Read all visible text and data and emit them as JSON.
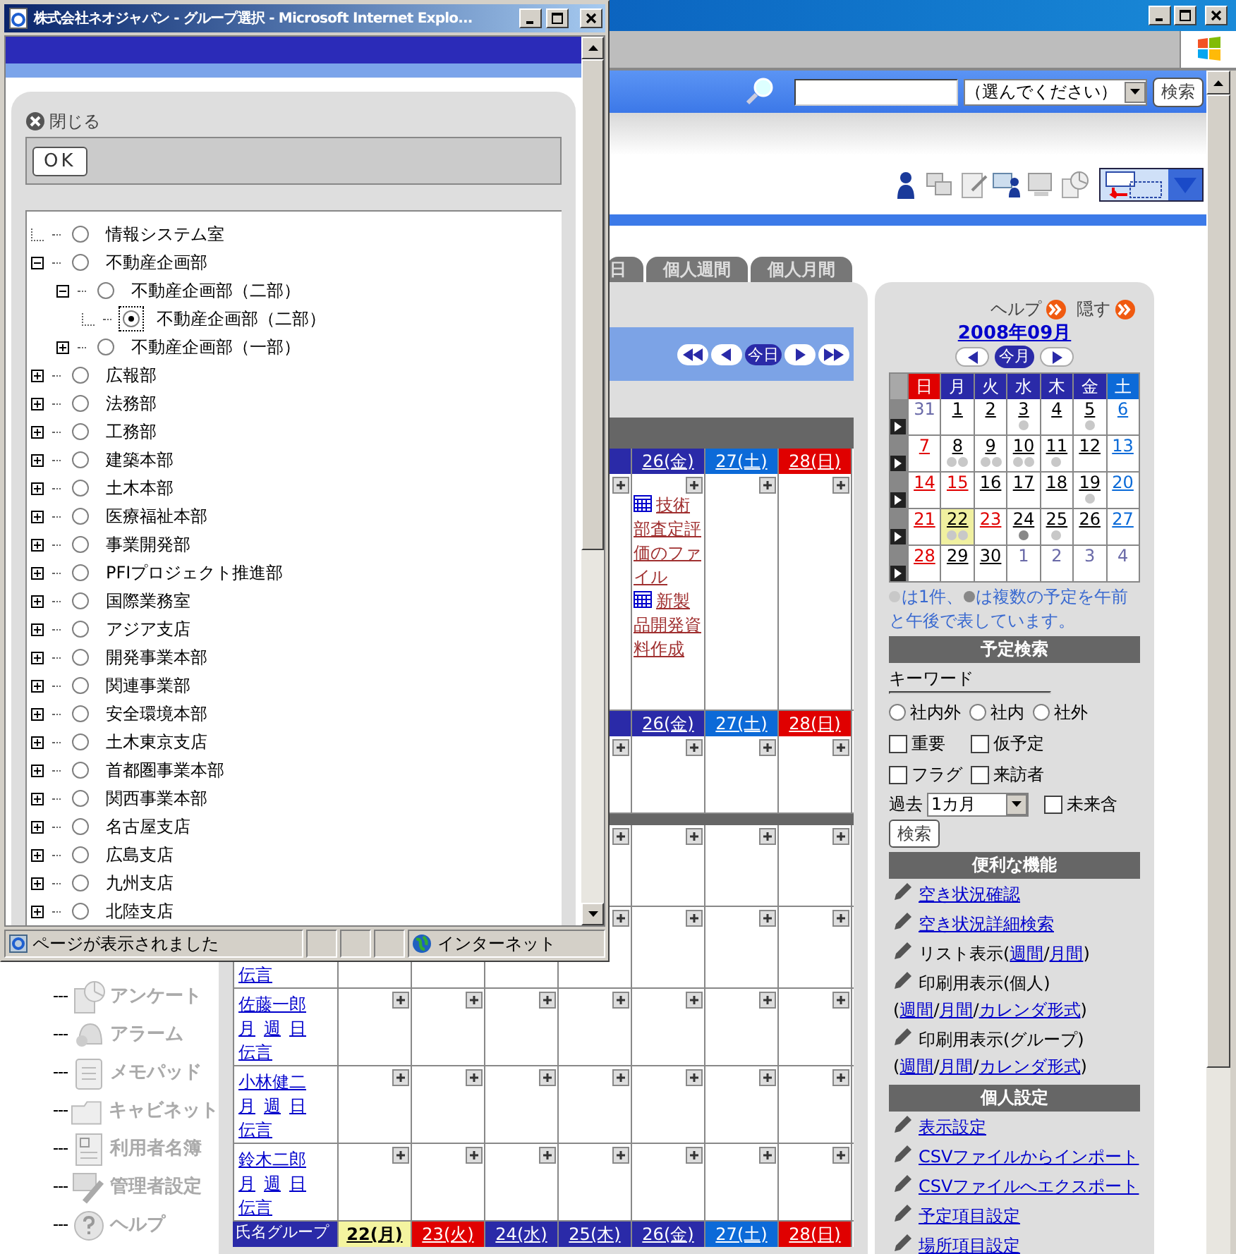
{
  "popup": {
    "title": "株式会社ネオジャパン - グループ選択 - Microsoft Internet Explo...",
    "close_label": "閉じる",
    "ok_button": "OK",
    "tree": [
      {
        "label": "情報システム室",
        "kind": "leaf",
        "selected": false
      },
      {
        "label": "不動産企画部",
        "kind": "branch",
        "expanded": true,
        "selected": false,
        "children": [
          {
            "label": "不動産企画部（二部）",
            "kind": "branch",
            "expanded": true,
            "selected": false,
            "children": [
              {
                "label": "不動産企画部（二部）",
                "kind": "leaf",
                "selected": true
              }
            ]
          },
          {
            "label": "不動産企画部（一部）",
            "kind": "branch",
            "expanded": false,
            "selected": false
          }
        ]
      },
      {
        "label": "広報部",
        "kind": "branch",
        "expanded": false,
        "selected": false
      },
      {
        "label": "法務部",
        "kind": "branch",
        "expanded": false,
        "selected": false
      },
      {
        "label": "工務部",
        "kind": "branch",
        "expanded": false,
        "selected": false
      },
      {
        "label": "建築本部",
        "kind": "branch",
        "expanded": false,
        "selected": false
      },
      {
        "label": "土木本部",
        "kind": "branch",
        "expanded": false,
        "selected": false
      },
      {
        "label": "医療福祉本部",
        "kind": "branch",
        "expanded": false,
        "selected": false
      },
      {
        "label": "事業開発部",
        "kind": "branch",
        "expanded": false,
        "selected": false
      },
      {
        "label": "PFIプロジェクト推進部",
        "kind": "branch",
        "expanded": false,
        "selected": false
      },
      {
        "label": "国際業務室",
        "kind": "branch",
        "expanded": false,
        "selected": false
      },
      {
        "label": "アジア支店",
        "kind": "branch",
        "expanded": false,
        "selected": false
      },
      {
        "label": "開発事業本部",
        "kind": "branch",
        "expanded": false,
        "selected": false
      },
      {
        "label": "関連事業部",
        "kind": "branch",
        "expanded": false,
        "selected": false
      },
      {
        "label": "安全環境本部",
        "kind": "branch",
        "expanded": false,
        "selected": false
      },
      {
        "label": "土木東京支店",
        "kind": "branch",
        "expanded": false,
        "selected": false
      },
      {
        "label": "首都圏事業本部",
        "kind": "branch",
        "expanded": false,
        "selected": false
      },
      {
        "label": "関西事業本部",
        "kind": "branch",
        "expanded": false,
        "selected": false
      },
      {
        "label": "名古屋支店",
        "kind": "branch",
        "expanded": false,
        "selected": false
      },
      {
        "label": "広島支店",
        "kind": "branch",
        "expanded": false,
        "selected": false
      },
      {
        "label": "九州支店",
        "kind": "branch",
        "expanded": false,
        "selected": false
      },
      {
        "label": "北陸支店",
        "kind": "branch",
        "expanded": false,
        "selected": false
      }
    ],
    "status_text": "ページが表示されました",
    "zone": "インターネット"
  },
  "search_bar": {
    "scope": "（選んでください）",
    "button": "検索"
  },
  "tabs": [
    {
      "label": "日",
      "selected": false
    },
    {
      "label": "個人週間",
      "selected": false
    },
    {
      "label": "個人月間",
      "selected": false
    }
  ],
  "schedule": {
    "today_button": "今日",
    "rows": [
      {
        "kind": "bar"
      },
      {
        "kind": "header",
        "days": [
          {
            "label": "26(金)",
            "kind": "weekday"
          },
          {
            "label": "27(土)",
            "kind": "sat"
          },
          {
            "label": "28(日)",
            "kind": "sun"
          }
        ]
      },
      {
        "kind": "member",
        "cells": [
          {},
          {},
          {},
          {},
          {
            "events": [
              "技術部査定評価のファイル",
              "新製品開発資料作成"
            ]
          },
          {},
          {}
        ]
      },
      {
        "kind": "header",
        "days": [
          {
            "label": "26(金)",
            "kind": "weekday"
          },
          {
            "label": "27(土)",
            "kind": "sat"
          },
          {
            "label": "28(日)",
            "kind": "sun"
          }
        ]
      },
      {
        "kind": "member",
        "cells": [
          {},
          {},
          {},
          {},
          {},
          {},
          {}
        ]
      },
      {
        "kind": "bar"
      },
      {
        "kind": "member",
        "cells": [
          {},
          {},
          {},
          {},
          {},
          {},
          {}
        ]
      },
      {
        "kind": "member",
        "message": "伝言",
        "cells": [
          {},
          {},
          {},
          {},
          {},
          {},
          {}
        ]
      },
      {
        "kind": "member",
        "name": "佐藤一郎",
        "links": [
          "月",
          "週",
          "日"
        ],
        "message": "伝言",
        "cells": [
          {},
          {},
          {},
          {},
          {},
          {},
          {}
        ]
      },
      {
        "kind": "member",
        "name": "小林健二",
        "links": [
          "月",
          "週",
          "日"
        ],
        "message": "伝言",
        "cells": [
          {},
          {},
          {},
          {},
          {},
          {},
          {}
        ]
      },
      {
        "kind": "member",
        "name": "鈴木二郎",
        "links": [
          "月",
          "週",
          "日"
        ],
        "message": "伝言",
        "cells": [
          {},
          {},
          {},
          {},
          {},
          {},
          {}
        ]
      },
      {
        "kind": "header",
        "corner": "氏名グループ",
        "days": [
          {
            "label": "22(月)",
            "kind": "today"
          },
          {
            "label": "23(火)",
            "kind": "sun"
          },
          {
            "label": "24(水)",
            "kind": "weekday"
          },
          {
            "label": "25(木)",
            "kind": "weekday"
          },
          {
            "label": "26(金)",
            "kind": "weekday"
          },
          {
            "label": "27(土)",
            "kind": "sat"
          },
          {
            "label": "28(日)",
            "kind": "sun"
          }
        ]
      }
    ]
  },
  "sidebar": {
    "items": [
      {
        "label": "アンケート",
        "kind": "survey"
      },
      {
        "label": "アラーム",
        "kind": "alarm"
      },
      {
        "label": "メモパッド",
        "kind": "memo"
      },
      {
        "label": "キャビネット",
        "kind": "cabinet"
      },
      {
        "label": "利用者名簿",
        "kind": "directory"
      },
      {
        "label": "管理者設定",
        "kind": "admin"
      },
      {
        "label": "ヘルプ",
        "kind": "help"
      }
    ]
  },
  "side_panel": {
    "help": "ヘルプ",
    "hide": "隠す",
    "month": "2008年09月",
    "this_month": "今月",
    "weekdays": [
      {
        "label": "日",
        "kind": "sun"
      },
      {
        "label": "月",
        "kind": "weekday"
      },
      {
        "label": "火",
        "kind": "weekday"
      },
      {
        "label": "水",
        "kind": "weekday"
      },
      {
        "label": "木",
        "kind": "weekday"
      },
      {
        "label": "金",
        "kind": "weekday"
      },
      {
        "label": "土",
        "kind": "sat"
      }
    ],
    "weeks": [
      [
        {
          "label": "31",
          "kind": "other"
        },
        {
          "label": "1",
          "kind": "weekday"
        },
        {
          "label": "2",
          "kind": "weekday"
        },
        {
          "label": "3",
          "kind": "weekday",
          "dots": [
            {
              "kind": "single"
            }
          ]
        },
        {
          "label": "4",
          "kind": "weekday"
        },
        {
          "label": "5",
          "kind": "weekday",
          "dots": [
            {
              "kind": "single"
            }
          ]
        },
        {
          "label": "6",
          "kind": "sat"
        }
      ],
      [
        {
          "label": "7",
          "kind": "sun"
        },
        {
          "label": "8",
          "kind": "weekday",
          "dots": [
            {
              "kind": "single"
            },
            {
              "kind": "single"
            }
          ]
        },
        {
          "label": "9",
          "kind": "weekday",
          "dots": [
            {
              "kind": "single"
            },
            {
              "kind": "single"
            }
          ]
        },
        {
          "label": "10",
          "kind": "weekday",
          "dots": [
            {
              "kind": "single"
            },
            {
              "kind": "single"
            }
          ]
        },
        {
          "label": "11",
          "kind": "weekday",
          "dots": [
            {
              "kind": "single"
            }
          ]
        },
        {
          "label": "12",
          "kind": "weekday"
        },
        {
          "label": "13",
          "kind": "sat"
        }
      ],
      [
        {
          "label": "14",
          "kind": "sun"
        },
        {
          "label": "15",
          "kind": "sun"
        },
        {
          "label": "16",
          "kind": "weekday"
        },
        {
          "label": "17",
          "kind": "weekday"
        },
        {
          "label": "18",
          "kind": "weekday"
        },
        {
          "label": "19",
          "kind": "weekday",
          "dots": [
            {
              "kind": "single"
            }
          ]
        },
        {
          "label": "20",
          "kind": "sat"
        }
      ],
      [
        {
          "label": "21",
          "kind": "sun"
        },
        {
          "label": "22",
          "kind": "today",
          "dots": [
            {
              "kind": "single"
            },
            {
              "kind": "single"
            }
          ]
        },
        {
          "label": "23",
          "kind": "sun"
        },
        {
          "label": "24",
          "kind": "weekday",
          "dots": [
            {
              "kind": "multi"
            }
          ]
        },
        {
          "label": "25",
          "kind": "weekday",
          "dots": [
            {
              "kind": "single"
            }
          ]
        },
        {
          "label": "26",
          "kind": "weekday"
        },
        {
          "label": "27",
          "kind": "sat"
        }
      ],
      [
        {
          "label": "28",
          "kind": "sun"
        },
        {
          "label": "29",
          "kind": "weekday"
        },
        {
          "label": "30",
          "kind": "weekday"
        },
        {
          "label": "1",
          "kind": "other"
        },
        {
          "label": "2",
          "kind": "other"
        },
        {
          "label": "3",
          "kind": "other"
        },
        {
          "label": "4",
          "kind": "other"
        }
      ]
    ],
    "legend": [
      {
        "color": "#c8c8c8",
        "text": "は1件、"
      },
      {
        "color": "#888888",
        "text": "は複数の予定を午前と午後で表しています。"
      }
    ],
    "search": {
      "title": "予定検索",
      "keyword_label": "キーワード",
      "scopes": [
        {
          "label": "社内外",
          "selected": false
        },
        {
          "label": "社内",
          "selected": false
        },
        {
          "label": "社外",
          "selected": false
        }
      ],
      "flags": [
        {
          "label": "重要",
          "checked": false
        },
        {
          "label": "仮予定",
          "checked": false
        },
        {
          "label": "フラグ",
          "checked": false
        },
        {
          "label": "来訪者",
          "checked": false
        }
      ],
      "past_label": "過去",
      "past_value": "1カ月",
      "future": {
        "label": "未来含",
        "checked": false
      },
      "button": "検索"
    },
    "sections": [
      {
        "title": "便利な機能",
        "items": [
          {
            "lines": [
              [
                {
                  "text": "空き状況確認",
                  "kind": "link"
                }
              ]
            ]
          },
          {
            "lines": [
              [
                {
                  "text": "空き状況詳細検索",
                  "kind": "link"
                }
              ]
            ]
          },
          {
            "lines": [
              [
                {
                  "text": "リスト表示(",
                  "kind": "plain"
                },
                {
                  "text": "週間",
                  "kind": "link"
                },
                {
                  "text": "/",
                  "kind": "plain"
                },
                {
                  "text": "月間",
                  "kind": "link"
                },
                {
                  "text": ")",
                  "kind": "plain"
                }
              ]
            ]
          },
          {
            "lines": [
              [
                {
                  "text": "印刷用表示(個人)",
                  "kind": "plain"
                }
              ],
              [
                {
                  "text": "(",
                  "kind": "plain"
                },
                {
                  "text": "週間",
                  "kind": "link"
                },
                {
                  "text": "/",
                  "kind": "plain"
                },
                {
                  "text": "月間",
                  "kind": "link"
                },
                {
                  "text": "/",
                  "kind": "plain"
                },
                {
                  "text": "カレンダ形式",
                  "kind": "link"
                },
                {
                  "text": ")",
                  "kind": "plain"
                }
              ]
            ]
          },
          {
            "lines": [
              [
                {
                  "text": "印刷用表示(グループ)",
                  "kind": "plain"
                }
              ],
              [
                {
                  "text": "(",
                  "kind": "plain"
                },
                {
                  "text": "週間",
                  "kind": "link"
                },
                {
                  "text": "/",
                  "kind": "plain"
                },
                {
                  "text": "月間",
                  "kind": "link"
                },
                {
                  "text": "/",
                  "kind": "plain"
                },
                {
                  "text": "カレンダ形式",
                  "kind": "link"
                },
                {
                  "text": ")",
                  "kind": "plain"
                }
              ]
            ]
          }
        ]
      },
      {
        "title": "個人設定",
        "items": [
          {
            "lines": [
              [
                {
                  "text": "表示設定",
                  "kind": "link"
                }
              ]
            ]
          },
          {
            "lines": [
              [
                {
                  "text": "CSVファイルからインポート",
                  "kind": "link"
                }
              ]
            ]
          },
          {
            "lines": [
              [
                {
                  "text": "CSVファイルへエクスポート",
                  "kind": "link"
                }
              ]
            ]
          },
          {
            "lines": [
              [
                {
                  "text": "予定項目設定",
                  "kind": "link"
                }
              ]
            ]
          },
          {
            "lines": [
              [
                {
                  "text": "場所項目設定",
                  "kind": "link"
                }
              ]
            ]
          }
        ]
      }
    ]
  }
}
